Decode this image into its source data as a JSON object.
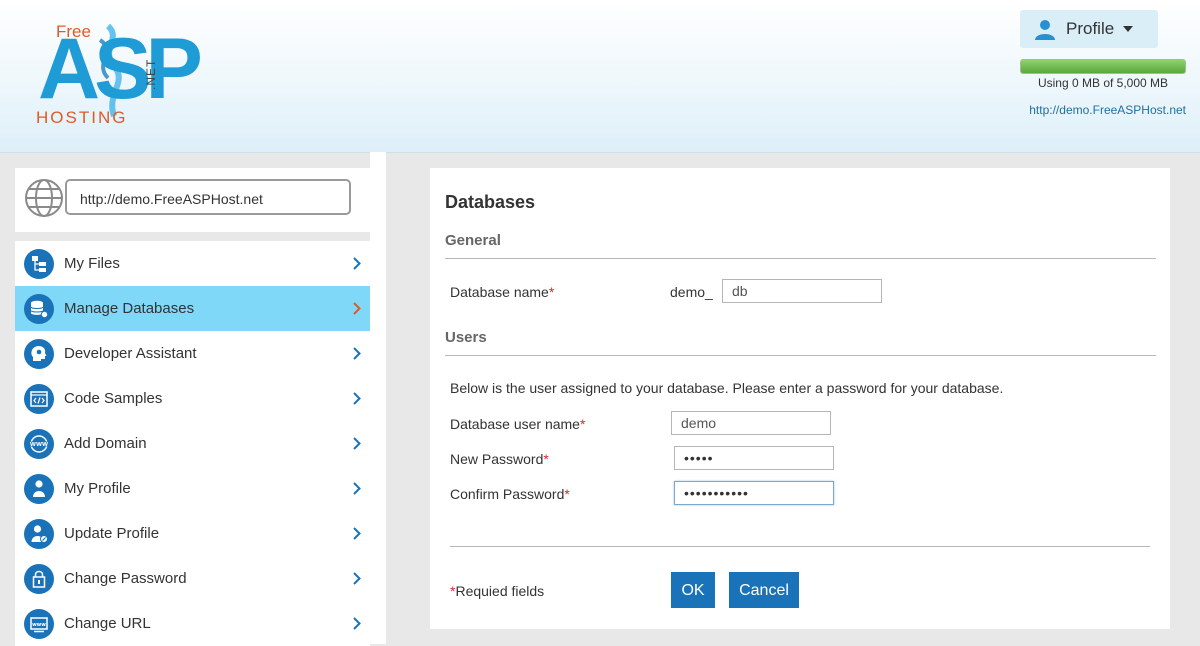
{
  "header": {
    "logo": {
      "free": "Free",
      "asp": "ASP",
      "hosting": "HOSTING",
      "net": ".NET"
    },
    "profile_label": "Profile",
    "usage_text": "Using 0 MB of 5,000 MB",
    "usage_fraction": 0.0,
    "site_url": "http://demo.FreeASPHost.net"
  },
  "sidebar": {
    "url": "http://demo.FreeASPHost.net",
    "items": [
      {
        "label": "My Files",
        "icon": "folder-tree-icon"
      },
      {
        "label": "Manage Databases",
        "icon": "database-icon",
        "active": true
      },
      {
        "label": "Developer Assistant",
        "icon": "head-gear-icon"
      },
      {
        "label": "Code Samples",
        "icon": "code-icon"
      },
      {
        "label": "Add Domain",
        "icon": "www-icon"
      },
      {
        "label": "My Profile",
        "icon": "user-icon"
      },
      {
        "label": "Update Profile",
        "icon": "user-edit-icon"
      },
      {
        "label": "Change Password",
        "icon": "lock-icon"
      },
      {
        "label": "Change URL",
        "icon": "url-icon"
      }
    ]
  },
  "main": {
    "title": "Databases",
    "general_heading": "General",
    "db_name_label": "Database name",
    "db_prefix": "demo_",
    "db_name_value": "db",
    "users_heading": "Users",
    "info_text": "Below is the user assigned to your database. Please enter a password for your database.",
    "user_name_label": "Database user name",
    "user_name_value": "demo",
    "new_password_label": "New Password",
    "new_password_value": "•••••",
    "confirm_password_label": "Confirm Password",
    "confirm_password_value": "•••••••••••",
    "required_star": "*",
    "required_text": "Requied fields",
    "ok_label": "OK",
    "cancel_label": "Cancel"
  },
  "colors": {
    "accent": "#1a73b8",
    "active_menu": "#7fd8f8",
    "icon_blue": "#1a73b8",
    "required": "#d9252b",
    "chevron": "#1a73b8",
    "chevron_active": "#e05a24"
  }
}
